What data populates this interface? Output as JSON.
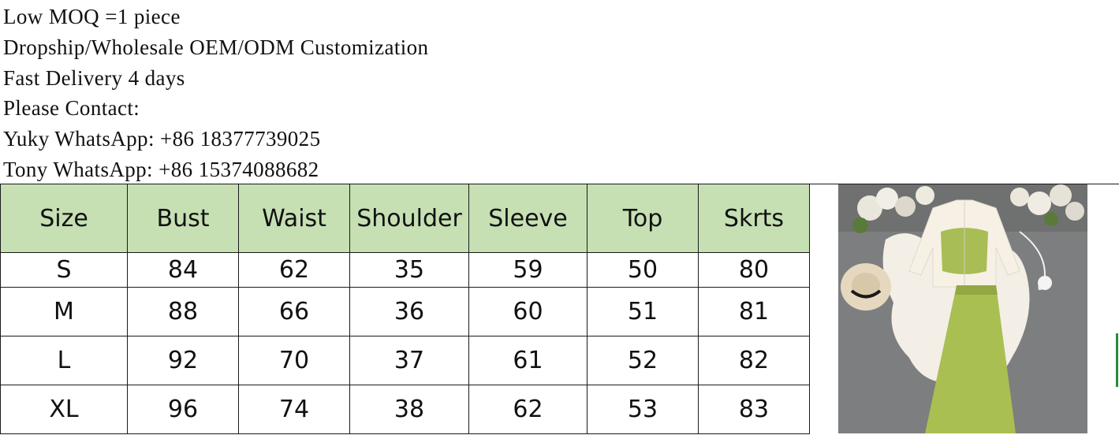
{
  "info": {
    "lines": [
      "Low MOQ =1 piece",
      "Dropship/Wholesale OEM/ODM Customization",
      "Fast Delivery 4 days",
      "Please Contact:",
      "Yuky WhatsApp: +86 18377739025",
      "Tony WhatsApp: +86 15374088682"
    ]
  },
  "table": {
    "headers": [
      "Size",
      "Bust",
      "Waist",
      "Shoulder",
      "Sleeve",
      "Top",
      "Skrts"
    ],
    "rows": [
      [
        "S",
        "84",
        "62",
        "35",
        "59",
        "50",
        "80"
      ],
      [
        "M",
        "88",
        "66",
        "36",
        "60",
        "51",
        "81"
      ],
      [
        "L",
        "92",
        "70",
        "37",
        "61",
        "52",
        "82"
      ],
      [
        "XL",
        "96",
        "74",
        "38",
        "62",
        "53",
        "83"
      ]
    ],
    "header_bg": "#c6e0b4"
  },
  "product": {
    "image_icon": "product-photo",
    "skirt_color": "#a9bf52",
    "blouse_color": "#f4efe2"
  }
}
